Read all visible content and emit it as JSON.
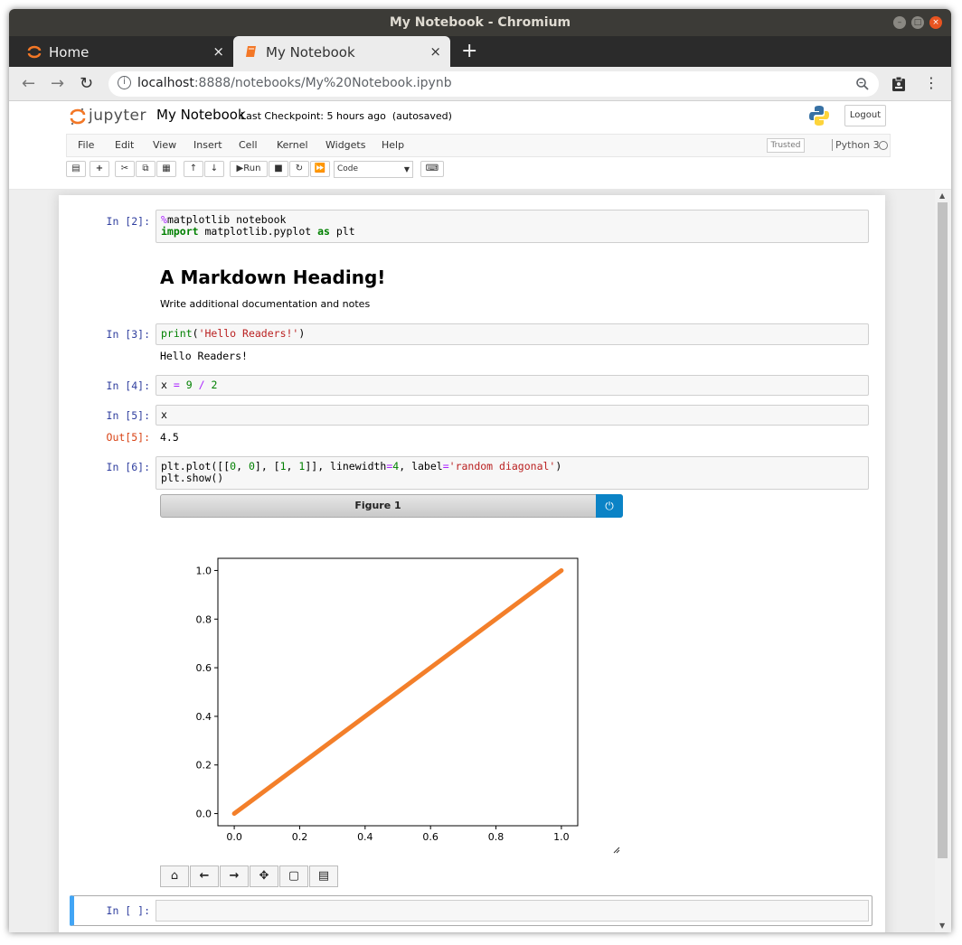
{
  "window": {
    "title": "My Notebook - Chromium"
  },
  "tabs": [
    {
      "label": "Home",
      "close": "×"
    },
    {
      "label": "My Notebook",
      "close": "×"
    }
  ],
  "newtab": "+",
  "address": {
    "host": "localhost",
    "path": ":8888/notebooks/My%20Notebook.ipynb"
  },
  "jupyter": {
    "logo_text": "jupyter",
    "notebook_name": "My Notebook",
    "checkpoint": "Last Checkpoint: 5 hours ago",
    "autosaved": "(autosaved)",
    "logout": "Logout",
    "menu": [
      "File",
      "Edit",
      "View",
      "Insert",
      "Cell",
      "Kernel",
      "Widgets",
      "Help"
    ],
    "trusted": "Trusted",
    "kernel": "Python 3",
    "run_label": "Run",
    "cell_type": "Code"
  },
  "cells": {
    "c1_prompt": "In [2]:",
    "c1_line1_magic": "%",
    "c1_line1_rest": "matplotlib notebook",
    "c1_line2_kw1": "import",
    "c1_line2_mid": " matplotlib.pyplot ",
    "c1_line2_kw2": "as",
    "c1_line2_end": " plt",
    "md_heading": "A Markdown Heading!",
    "md_text": "Write additional documentation and notes",
    "c2_prompt": "In [3]:",
    "c2_fn": "print",
    "c2_open": "(",
    "c2_str": "'Hello Readers!'",
    "c2_close": ")",
    "c2_output": "Hello Readers!",
    "c3_prompt": "In [4]:",
    "c3_a": "x ",
    "c3_eq": "=",
    "c3_b": " ",
    "c3_n1": "9",
    "c3_c": " ",
    "c3_div": "/",
    "c3_d": " ",
    "c3_n2": "2",
    "c4_prompt": "In [5]:",
    "c4_code": "x",
    "c4_out_prompt": "Out[5]:",
    "c4_output": "4.5",
    "c5_prompt": "In [6]:",
    "c5_l1_a": "plt.plot([[",
    "c5_l1_n1": "0",
    "c5_l1_b": ", ",
    "c5_l1_n2": "0",
    "c5_l1_c": "], [",
    "c5_l1_n3": "1",
    "c5_l1_d": ", ",
    "c5_l1_n4": "1",
    "c5_l1_e": "]], linewidth",
    "c5_l1_eq1": "=",
    "c5_l1_n5": "4",
    "c5_l1_f": ", label",
    "c5_l1_eq2": "=",
    "c5_l1_str": "'random diagonal'",
    "c5_l1_g": ")",
    "c5_l2": "plt.show()",
    "figure_title": "Figure 1",
    "empty_prompt": "In [ ]:"
  },
  "chart_data": {
    "type": "line",
    "title": "",
    "xlabel": "",
    "ylabel": "",
    "xlim": [
      -0.05,
      1.05
    ],
    "ylim": [
      -0.05,
      1.05
    ],
    "xticks": [
      "0.0",
      "0.2",
      "0.4",
      "0.6",
      "0.8",
      "1.0"
    ],
    "yticks": [
      "0.0",
      "0.2",
      "0.4",
      "0.6",
      "0.8",
      "1.0"
    ],
    "series": [
      {
        "x": [
          0,
          1
        ],
        "y": [
          0,
          1
        ],
        "color": "#f37f2a"
      }
    ],
    "grid": false
  }
}
